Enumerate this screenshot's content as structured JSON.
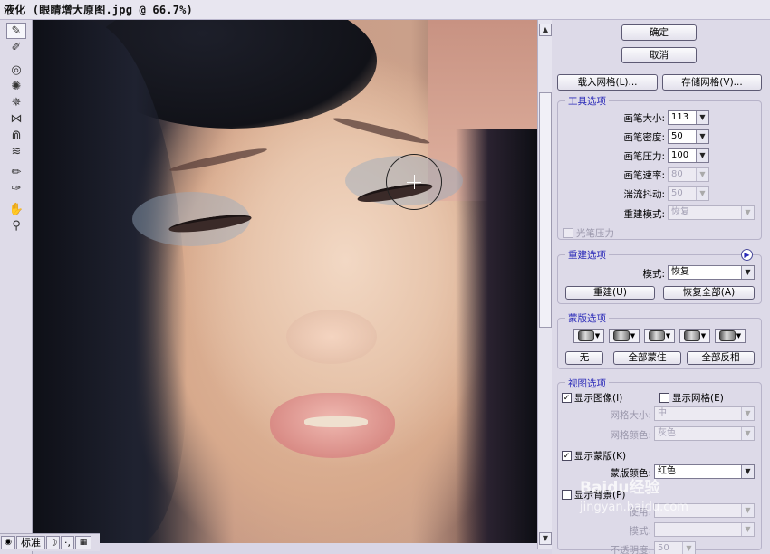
{
  "window": {
    "title": "液化 (眼睛增大原图.jpg @ 66.7%)"
  },
  "tools": [
    {
      "name": "forward-warp-tool-icon",
      "glyph": "✎",
      "active": true
    },
    {
      "name": "reconstruct-tool-icon",
      "glyph": "✐"
    },
    {
      "name": "twirl-clockwise-tool-icon",
      "glyph": "◎"
    },
    {
      "name": "pucker-tool-icon",
      "glyph": "✺"
    },
    {
      "name": "bloat-tool-icon",
      "glyph": "✵"
    },
    {
      "name": "push-left-tool-icon",
      "glyph": "⋈"
    },
    {
      "name": "mirror-tool-icon",
      "glyph": "⋒"
    },
    {
      "name": "turbulence-tool-icon",
      "glyph": "≋"
    },
    {
      "name": "freeze-mask-tool-icon",
      "glyph": "✏"
    },
    {
      "name": "thaw-mask-tool-icon",
      "glyph": "✑"
    },
    {
      "name": "hand-tool-icon",
      "glyph": "✋"
    },
    {
      "name": "zoom-tool-icon",
      "glyph": "⚲"
    }
  ],
  "buttons": {
    "ok": "确定",
    "cancel": "取消",
    "load_mesh": "载入网格(L)...",
    "save_mesh": "存储网格(V)..."
  },
  "tool_options": {
    "legend": "工具选项",
    "brush_size_label": "画笔大小:",
    "brush_size": "113",
    "brush_density_label": "画笔密度:",
    "brush_density": "50",
    "brush_pressure_label": "画笔压力:",
    "brush_pressure": "100",
    "brush_rate_label": "画笔速率:",
    "brush_rate": "80",
    "turbulent_jitter_label": "湍流抖动:",
    "turbulent_jitter": "50",
    "reconstruct_mode_label": "重建模式:",
    "reconstruct_mode": "恢复",
    "stylus_pressure": "光笔压力"
  },
  "reconstruct_options": {
    "legend": "重建选项",
    "mode_label": "模式:",
    "mode": "恢复",
    "reconstruct": "重建(U)",
    "restore_all": "恢复全部(A)"
  },
  "mask_options": {
    "legend": "蒙版选项",
    "none": "无",
    "mask_all": "全部蒙住",
    "invert_all": "全部反相"
  },
  "view_options": {
    "legend": "视图选项",
    "show_image": "显示图像(I)",
    "show_image_checked": true,
    "show_mesh": "显示网格(E)",
    "show_mesh_checked": false,
    "mesh_size_label": "网格大小:",
    "mesh_size": "中",
    "mesh_color_label": "网格颜色:",
    "mesh_color": "灰色",
    "show_mask": "显示蒙版(K)",
    "show_mask_checked": true,
    "mask_color_label": "蒙版颜色:",
    "mask_color": "红色",
    "show_backdrop": "显示背景(P)",
    "show_backdrop_checked": false,
    "use_label": "使用:",
    "mode_label": "模式:",
    "opacity_label": "不透明度:",
    "opacity": "50"
  },
  "statusbar": {
    "view_mode": "标准"
  },
  "watermark": {
    "brand": "Baidu经验",
    "url": "jingyan.baidu.com"
  },
  "colors": {
    "panel_bg": "#dddae8",
    "legend_text": "#2a2ab8",
    "accent_border": "#5d5a74"
  }
}
